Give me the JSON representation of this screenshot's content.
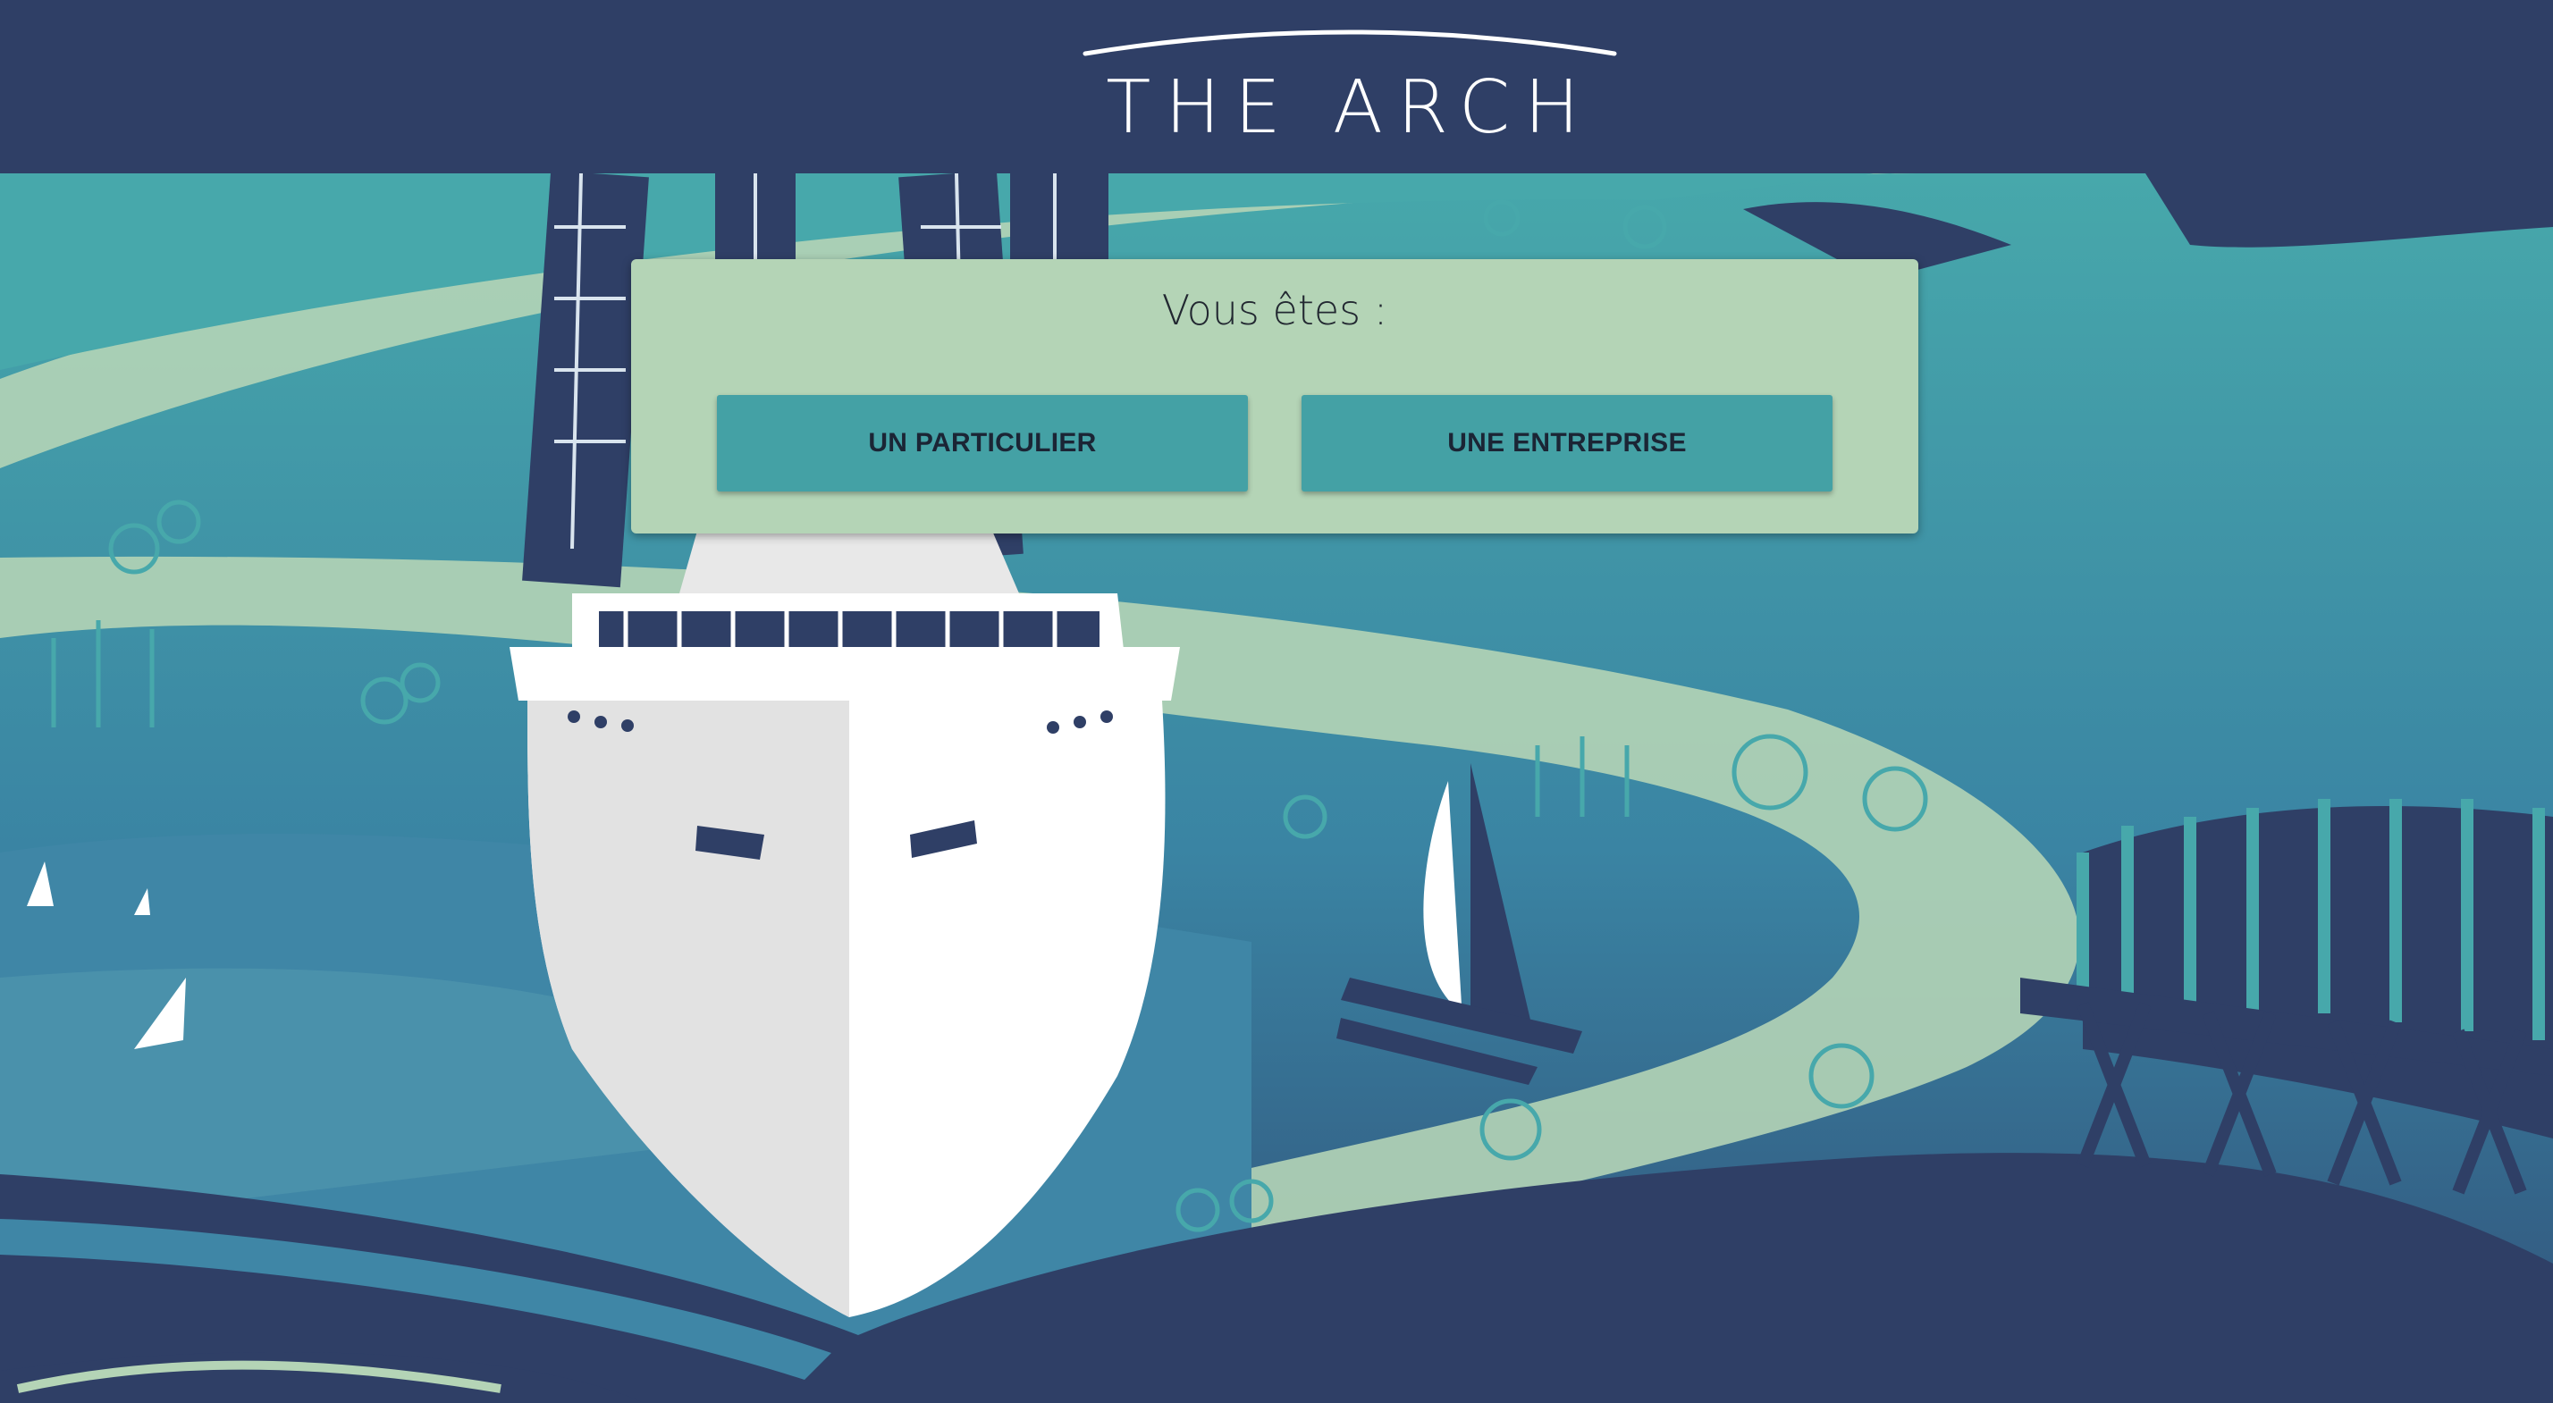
{
  "header": {
    "logo_text": "THE ARCH"
  },
  "question_card": {
    "title": "Vous êtes :",
    "buttons": {
      "particulier_label": "UN PARTICULIER",
      "entreprise_label": "UNE ENTREPRISE"
    }
  },
  "colors": {
    "header_bg": "#2f3f66",
    "card_bg": "#b4d4b6",
    "button_bg": "#44a1a5",
    "button_text": "#1b2535",
    "sea_teal": "#3f9ea6",
    "path_mint": "#b4d4b6",
    "ship_white": "#ffffff"
  },
  "icons": {
    "logo": "arch-logo",
    "background": "illustration-ship-on-open-book"
  }
}
